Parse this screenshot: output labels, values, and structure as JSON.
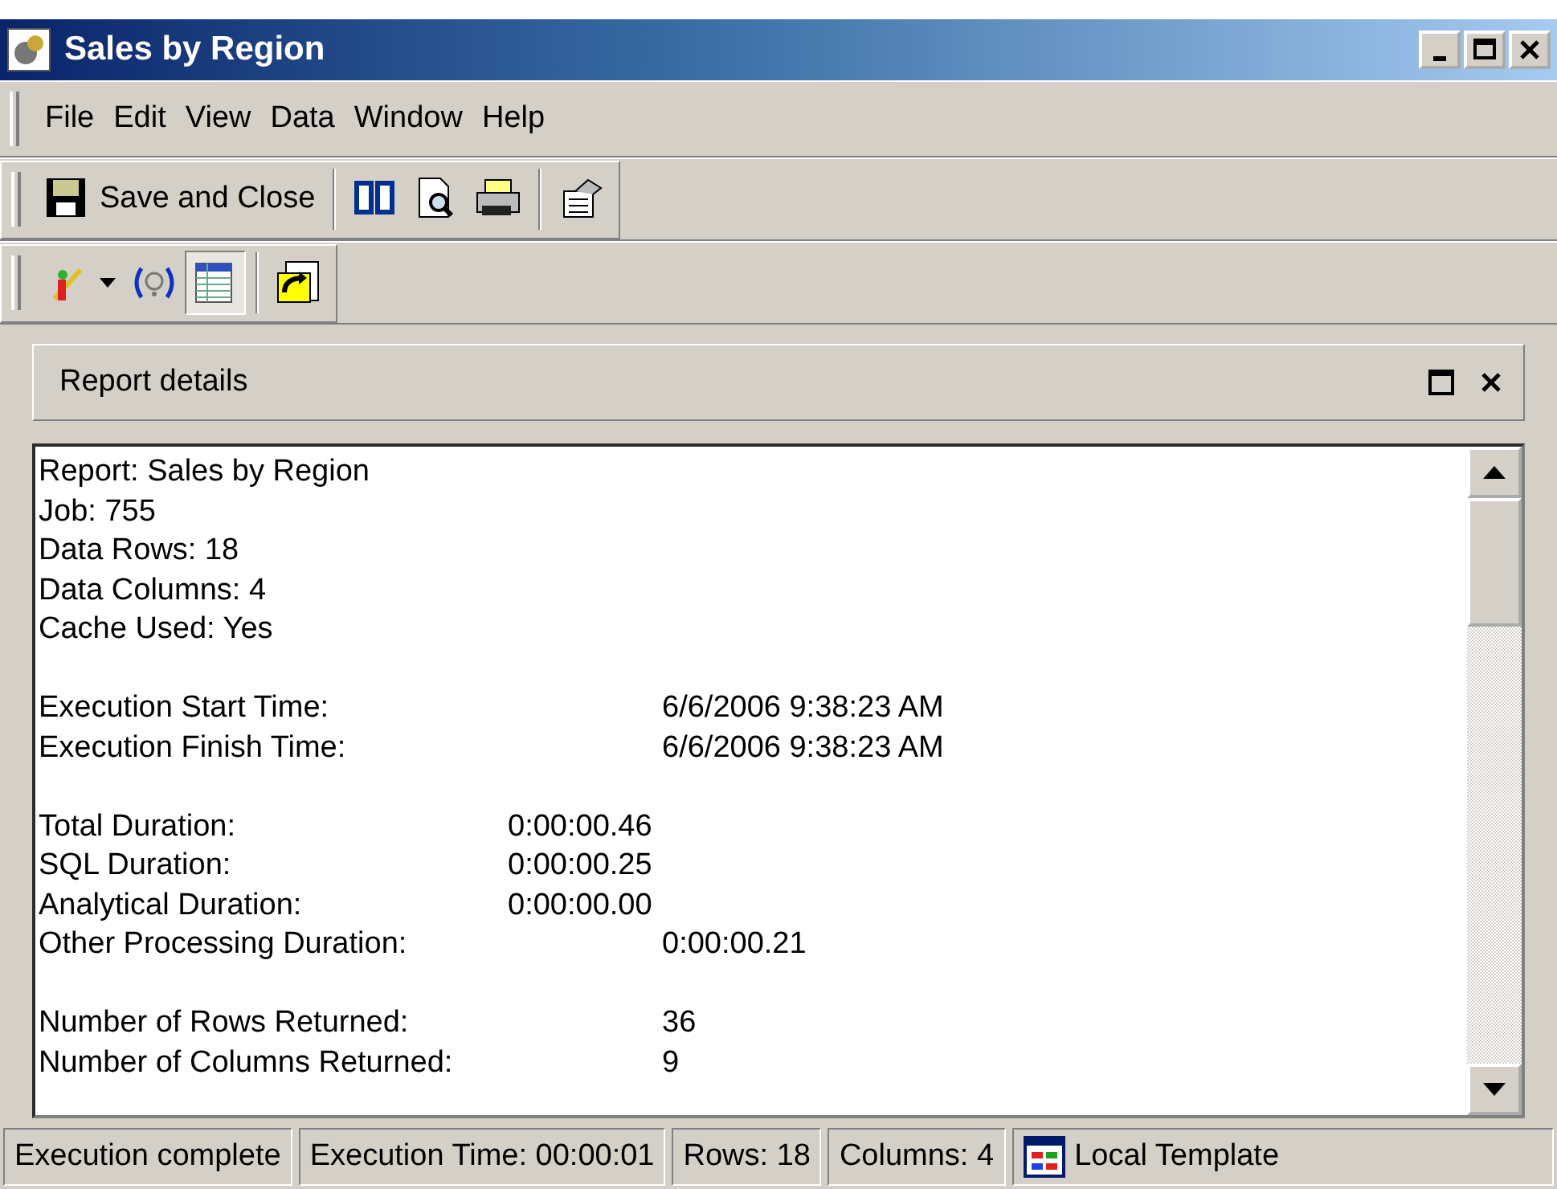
{
  "window": {
    "title": "Sales by Region"
  },
  "menu": [
    "File",
    "Edit",
    "View",
    "Data",
    "Window",
    "Help"
  ],
  "toolbar_1": [
    {
      "kind": "save",
      "label": "Save and Close"
    },
    {
      "kind": "separator"
    },
    {
      "kind": "book"
    },
    {
      "kind": "preview"
    },
    {
      "kind": "printer"
    },
    {
      "kind": "separator"
    },
    {
      "kind": "properties"
    }
  ],
  "toolbar_2": [
    {
      "kind": "wand",
      "pressed": false
    },
    {
      "kind": "help",
      "pressed": false
    },
    {
      "kind": "grid",
      "pressed": true
    },
    {
      "kind": "separator"
    },
    {
      "kind": "export",
      "pressed": false
    }
  ],
  "panel": {
    "title": "Report details"
  },
  "report_lines": [
    {
      "kind": "single",
      "label": "Report: Sales by Region"
    },
    {
      "kind": "single",
      "label": "Job: 755"
    },
    {
      "kind": "single",
      "label": "Data Rows: 18"
    },
    {
      "kind": "single",
      "label": "Data Columns: 4"
    },
    {
      "kind": "single",
      "label": "Cache Used: Yes"
    },
    {
      "kind": "blank"
    },
    {
      "kind": "far",
      "label": "Execution Start Time:",
      "value": "6/6/2006 9:38:23 AM"
    },
    {
      "kind": "far",
      "label": "Execution Finish Time:",
      "value": "6/6/2006 9:38:23 AM"
    },
    {
      "kind": "blank"
    },
    {
      "kind": "near",
      "label": "Total Duration:",
      "value": "0:00:00.46"
    },
    {
      "kind": "near",
      "label": "SQL Duration:",
      "value": "0:00:00.25"
    },
    {
      "kind": "near",
      "label": "Analytical Duration:",
      "value": "0:00:00.00"
    },
    {
      "kind": "far",
      "label": "Other Processing Duration:",
      "value": "0:00:00.21"
    },
    {
      "kind": "blank"
    },
    {
      "kind": "far",
      "label": "Number of Rows Returned:",
      "value": "36"
    },
    {
      "kind": "far",
      "label": "Number of Columns Returned:",
      "value": "9"
    }
  ],
  "status_bar": [
    {
      "kind": "text",
      "label": "Execution complete"
    },
    {
      "kind": "text",
      "label": "Execution Time: 00:00:01"
    },
    {
      "kind": "text",
      "label": "Rows: 18"
    },
    {
      "kind": "text",
      "label": "Columns: 4"
    },
    {
      "kind": "template",
      "label": "Local Template"
    }
  ]
}
